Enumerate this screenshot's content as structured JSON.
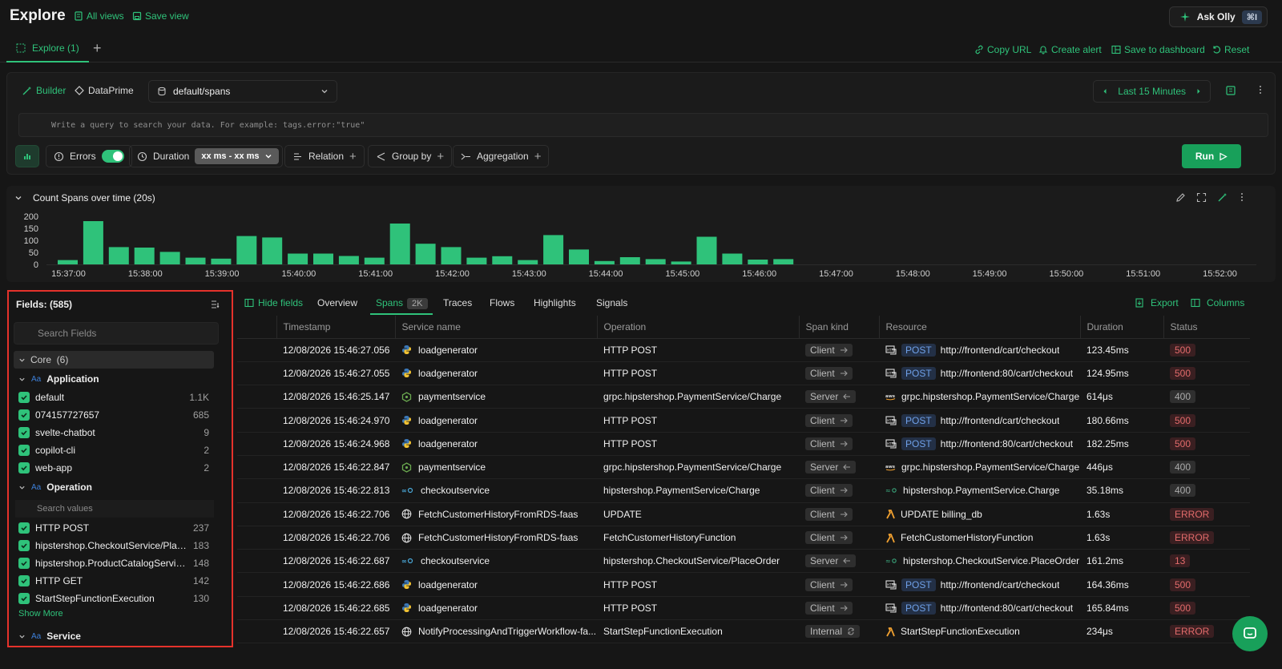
{
  "header": {
    "title": "Explore",
    "all_views": "All views",
    "save_view": "Save view",
    "ask_olly": "Ask Olly",
    "ask_olly_shortcut": "⌘I"
  },
  "tabs": {
    "explore": "Explore (1)",
    "add": "+"
  },
  "actions": {
    "copy_url": "Copy URL",
    "create_alert": "Create alert",
    "save_to_dashboard": "Save to dashboard",
    "reset": "Reset"
  },
  "query": {
    "builder": "Builder",
    "dataprime": "DataPrime",
    "dataset": "default/spans",
    "placeholder": "Write a query to search your data. For example: tags.error:\"true\"",
    "time_range": "Last 15 Minutes",
    "errors_label": "Errors",
    "duration_label": "Duration",
    "duration_value": "xx ms - xx ms",
    "relation": "Relation",
    "group_by": "Group by",
    "aggregation": "Aggregation",
    "run": "Run"
  },
  "chart_data": {
    "type": "bar",
    "title": "Count Spans over time (20s)",
    "y_ticks": [
      "200",
      "150",
      "100",
      "50",
      "0"
    ],
    "ylim": [
      0,
      200
    ],
    "x_ticks": [
      "15:37:00",
      "15:38:00",
      "15:39:00",
      "15:40:00",
      "15:41:00",
      "15:42:00",
      "15:43:00",
      "15:44:00",
      "15:45:00",
      "15:46:00",
      "15:47:00",
      "15:48:00",
      "15:49:00",
      "15:50:00",
      "15:51:00",
      "15:52:00"
    ],
    "values": [
      18,
      180,
      72,
      70,
      52,
      28,
      24,
      118,
      112,
      45,
      45,
      35,
      28,
      170,
      86,
      72,
      28,
      34,
      18,
      122,
      62,
      14,
      30,
      22,
      12,
      115,
      45,
      20,
      22
    ],
    "color": "#2fc27a"
  },
  "fields": {
    "title": "Fields: (585)",
    "search_placeholder": "Search Fields",
    "core": "Core  (6)",
    "application": {
      "label": "Application",
      "items": [
        {
          "label": "default",
          "count": "1.1K"
        },
        {
          "label": "074157727657",
          "count": "685"
        },
        {
          "label": "svelte-chatbot",
          "count": "9"
        },
        {
          "label": "copilot-cli",
          "count": "2"
        },
        {
          "label": "web-app",
          "count": "2"
        }
      ]
    },
    "operation": {
      "label": "Operation",
      "search_placeholder": "Search values",
      "items": [
        {
          "label": "HTTP POST",
          "count": "237"
        },
        {
          "label": "hipstershop.CheckoutService/Place...",
          "count": "183"
        },
        {
          "label": "hipstershop.ProductCatalogService/...",
          "count": "148"
        },
        {
          "label": "HTTP GET",
          "count": "142"
        },
        {
          "label": "StartStepFunctionExecution",
          "count": "130"
        }
      ]
    },
    "show_more": "Show More",
    "service": "Service",
    "aa": "Aa"
  },
  "table_tabs": {
    "hide_fields": "Hide fields",
    "overview": "Overview",
    "spans": "Spans",
    "spans_count": "2K",
    "traces": "Traces",
    "flows": "Flows",
    "highlights": "Highlights",
    "signals": "Signals",
    "export": "Export",
    "columns": "Columns"
  },
  "table": {
    "headers": [
      "Timestamp",
      "Service name",
      "Operation",
      "Span kind",
      "Resource",
      "Duration",
      "Status"
    ],
    "rows": [
      {
        "ts": "12/08/2026 15:46:27.056",
        "svc": "loadgenerator",
        "svc_icon": "python",
        "op": "HTTP POST",
        "kind": "Client",
        "res_icon": "http",
        "method": "POST",
        "res": "http://frontend/cart/checkout",
        "dur": "123.45ms",
        "status": "500"
      },
      {
        "ts": "12/08/2026 15:46:27.055",
        "svc": "loadgenerator",
        "svc_icon": "python",
        "op": "HTTP POST",
        "kind": "Client",
        "res_icon": "http",
        "method": "POST",
        "res": "http://frontend:80/cart/checkout",
        "dur": "124.95ms",
        "status": "500"
      },
      {
        "ts": "12/08/2026 15:46:25.147",
        "svc": "paymentservice",
        "svc_icon": "node",
        "op": "grpc.hipstershop.PaymentService/Charge",
        "kind": "Server",
        "res_icon": "aws",
        "method": "",
        "res": "grpc.hipstershop.PaymentService/Charge",
        "dur": "614μs",
        "status": "400"
      },
      {
        "ts": "12/08/2026 15:46:24.970",
        "svc": "loadgenerator",
        "svc_icon": "python",
        "op": "HTTP POST",
        "kind": "Client",
        "res_icon": "http",
        "method": "POST",
        "res": "http://frontend/cart/checkout",
        "dur": "180.66ms",
        "status": "500"
      },
      {
        "ts": "12/08/2026 15:46:24.968",
        "svc": "loadgenerator",
        "svc_icon": "python",
        "op": "HTTP POST",
        "kind": "Client",
        "res_icon": "http",
        "method": "POST",
        "res": "http://frontend:80/cart/checkout",
        "dur": "182.25ms",
        "status": "500"
      },
      {
        "ts": "12/08/2026 15:46:22.847",
        "svc": "paymentservice",
        "svc_icon": "node",
        "op": "grpc.hipstershop.PaymentService/Charge",
        "kind": "Server",
        "res_icon": "aws",
        "method": "",
        "res": "grpc.hipstershop.PaymentService/Charge",
        "dur": "446μs",
        "status": "400"
      },
      {
        "ts": "12/08/2026 15:46:22.813",
        "svc": "checkoutservice",
        "svc_icon": "go",
        "op": "hipstershop.PaymentService/Charge",
        "kind": "Client",
        "res_icon": "go",
        "method": "",
        "res": "hipstershop.PaymentService.Charge",
        "dur": "35.18ms",
        "status": "400"
      },
      {
        "ts": "12/08/2026 15:46:22.706",
        "svc": "FetchCustomerHistoryFromRDS-faas",
        "svc_icon": "globe",
        "op": "UPDATE",
        "kind": "Client",
        "res_icon": "lambda",
        "method": "",
        "res": "UPDATE billing_db",
        "dur": "1.63s",
        "status": "ERROR"
      },
      {
        "ts": "12/08/2026 15:46:22.706",
        "svc": "FetchCustomerHistoryFromRDS-faas",
        "svc_icon": "globe",
        "op": "FetchCustomerHistoryFunction",
        "kind": "Client",
        "res_icon": "lambda",
        "method": "",
        "res": "FetchCustomerHistoryFunction",
        "dur": "1.63s",
        "status": "ERROR"
      },
      {
        "ts": "12/08/2026 15:46:22.687",
        "svc": "checkoutservice",
        "svc_icon": "go",
        "op": "hipstershop.CheckoutService/PlaceOrder",
        "kind": "Server",
        "res_icon": "go",
        "method": "",
        "res": "hipstershop.CheckoutService.PlaceOrder",
        "dur": "161.2ms",
        "status": "13"
      },
      {
        "ts": "12/08/2026 15:46:22.686",
        "svc": "loadgenerator",
        "svc_icon": "python",
        "op": "HTTP POST",
        "kind": "Client",
        "res_icon": "http",
        "method": "POST",
        "res": "http://frontend/cart/checkout",
        "dur": "164.36ms",
        "status": "500"
      },
      {
        "ts": "12/08/2026 15:46:22.685",
        "svc": "loadgenerator",
        "svc_icon": "python",
        "op": "HTTP POST",
        "kind": "Client",
        "res_icon": "http",
        "method": "POST",
        "res": "http://frontend:80/cart/checkout",
        "dur": "165.84ms",
        "status": "500"
      },
      {
        "ts": "12/08/2026 15:46:22.657",
        "svc": "NotifyProcessingAndTriggerWorkflow-fa...",
        "svc_icon": "globe",
        "op": "StartStepFunctionExecution",
        "kind": "Internal",
        "res_icon": "lambda",
        "method": "",
        "res": "StartStepFunctionExecution",
        "dur": "234μs",
        "status": "ERROR"
      }
    ]
  }
}
